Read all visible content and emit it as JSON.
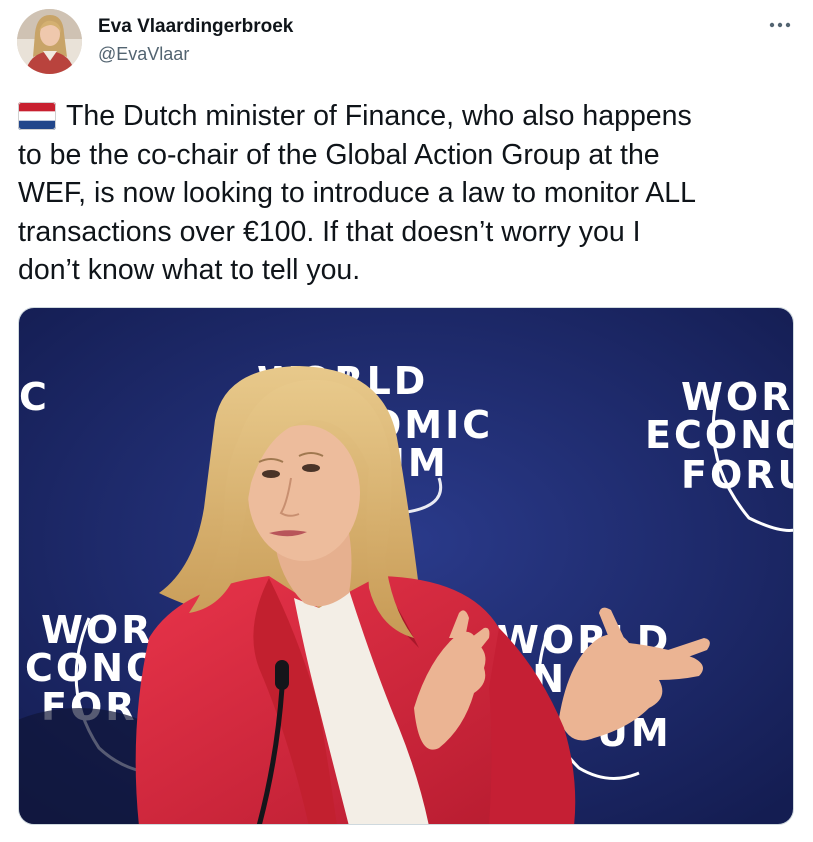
{
  "author": {
    "display_name": "Eva Vlaardingerbroek",
    "handle": "@EvaVlaar"
  },
  "more_menu_label": "···",
  "tweet": {
    "lines": [
      "The Dutch minister of Finance, who also happens",
      "to be the co-chair of the Global Action Group at the",
      "WEF, is now looking to introduce a law to monitor ALL",
      "transactions over €100. If that doesn’t worry you I",
      "don’t know what to tell you."
    ]
  },
  "media": {
    "backdrop_logos": [
      [
        "W",
        "ORLD",
        "OMIC",
        "UM"
      ],
      [
        "WOR",
        "ECONO",
        "FORU"
      ],
      [
        "WOR",
        "CONO",
        "FORU"
      ],
      [
        "WORLD",
        "ON",
        "UM"
      ],
      [
        "C"
      ]
    ]
  },
  "colors": {
    "text_primary": "#0f1419",
    "text_secondary": "#536471",
    "backdrop_blue": "#1f2a6b",
    "jacket_red": "#d8233a",
    "hair_blonde": "#d9b06a",
    "flag_red": "#c8202f",
    "flag_white": "#ffffff",
    "flag_blue": "#21468b"
  }
}
